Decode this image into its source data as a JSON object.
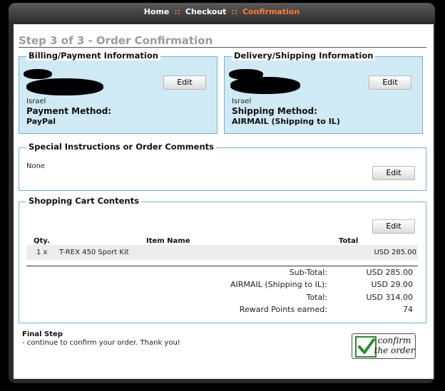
{
  "breadcrumb": {
    "home": "Home",
    "sep1": "::",
    "checkout": "Checkout",
    "sep2": "::",
    "confirmation": "Confirmation"
  },
  "step_title": "Step 3 of 3 - Order Confirmation",
  "billing": {
    "legend": "Billing/Payment Information",
    "edit_label": "Edit",
    "country": "Israel",
    "method_heading": "Payment Method:",
    "method_value": "PayPal"
  },
  "delivery": {
    "legend": "Delivery/Shipping Information",
    "edit_label": "Edit",
    "country": "Israel",
    "method_heading": "Shipping Method:",
    "method_value": "AIRMAIL (Shipping to IL)"
  },
  "comments": {
    "legend": "Special Instructions or Order Comments",
    "value": "None",
    "edit_label": "Edit"
  },
  "cart": {
    "legend": "Shopping Cart Contents",
    "edit_label": "Edit",
    "columns": {
      "qty": "Qty.",
      "item": "Item Name",
      "total": "Total"
    },
    "items": [
      {
        "qty": "1 x",
        "name": "T-REX 450 Sport Kit",
        "total": "USD 285.00"
      }
    ],
    "totals": {
      "subtotal_label": "Sub-Total:",
      "subtotal_value": "USD 285.00",
      "shipping_label": "AIRMAIL (Shipping to IL):",
      "shipping_value": "USD 29.00",
      "total_label": "Total:",
      "total_value": "USD 314.00",
      "points_label": "Reward Points earned:",
      "points_value": "74"
    }
  },
  "final_step": {
    "heading": "Final Step",
    "text": "- continue to confirm your order. Thank you!"
  },
  "confirm_button": {
    "line1": "confirm",
    "line2": "the order",
    "icon": "checkmark-icon"
  },
  "colors": {
    "accent_orange": "#ff7a33",
    "box_border": "#6bb5d6",
    "box_fill": "#cfeaf4",
    "check_green": "#2e8b2e"
  }
}
